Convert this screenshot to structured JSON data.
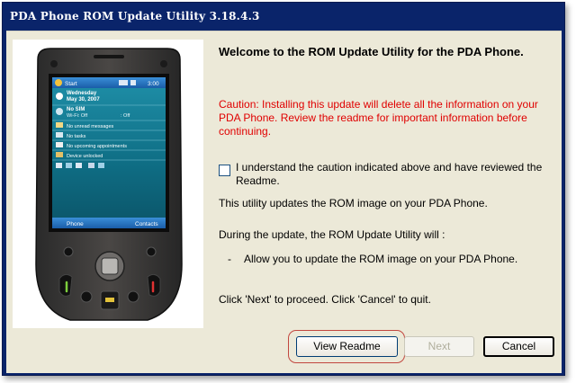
{
  "window": {
    "title": "PDA Phone ROM Update Utility 3.18.4.3"
  },
  "phone_screen": {
    "status_start": "Start",
    "status_time": "3:00",
    "date_day": "Wednesday",
    "date_full": "May 30, 2007",
    "sim_status": "No SIM",
    "wifi_status": "Wi-Fi: Off",
    "bt_status": ": Off",
    "messages": "No unread messages",
    "tasks": "No tasks",
    "appointments": "No upcoming appointments",
    "device_lock": "Device unlocked",
    "softkey_left": "Phone",
    "softkey_right": "Contacts"
  },
  "content": {
    "welcome": "Welcome to the ROM Update Utility for the PDA Phone.",
    "caution": "Caution: Installing this update will delete all the information on your PDA Phone. Review the readme for important information before continuing.",
    "agree_label": "I understand the caution indicated above and have reviewed the Readme.",
    "agree_checked": false,
    "utility_desc": "This utility updates the ROM image on your PDA Phone.",
    "during_update": "During the update, the ROM Update Utility will :",
    "bullet_dash": "-",
    "bullet_text": "Allow you to update the ROM image on your PDA Phone.",
    "proceed": "Click 'Next' to proceed. Click 'Cancel' to quit."
  },
  "buttons": {
    "view_readme": "View Readme",
    "next": "Next",
    "cancel": "Cancel"
  },
  "colors": {
    "titlebar": "#0a246a",
    "caution_text": "#e00000",
    "highlight": "#c2473f"
  }
}
